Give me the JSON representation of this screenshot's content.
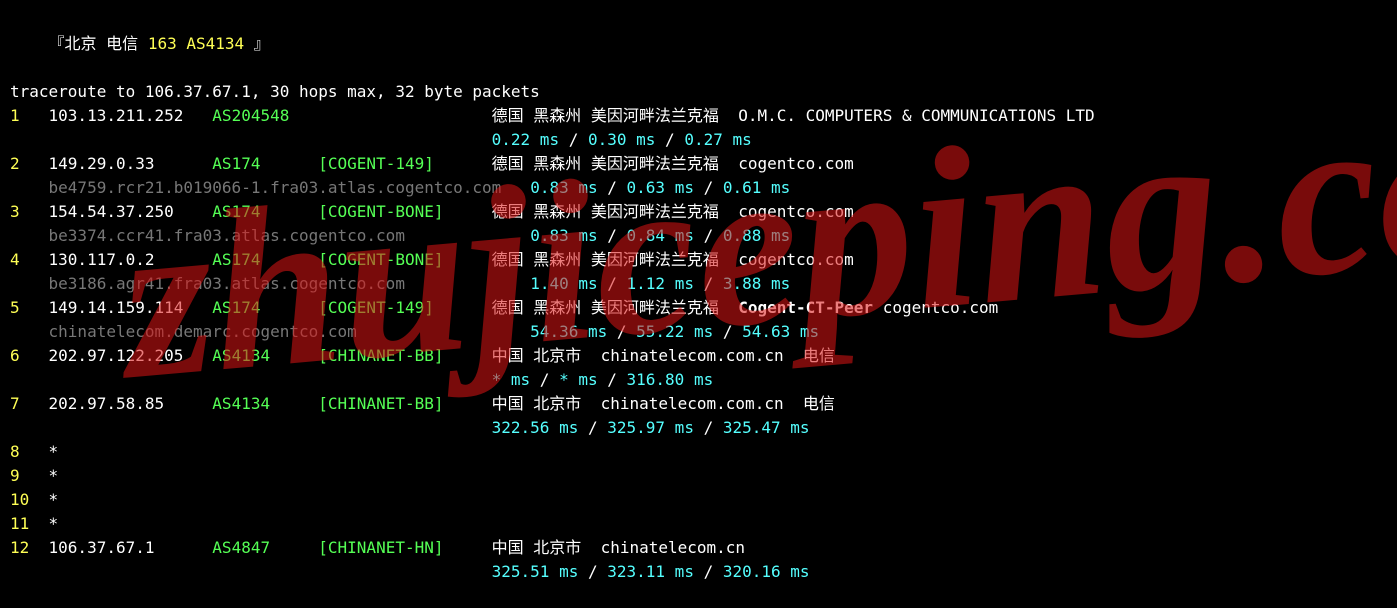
{
  "header": {
    "line1_prefix": "『北京 电信 ",
    "line1_yellow": "163 AS4134",
    "line1_suffix": " 』",
    "line2": "traceroute to 106.37.67.1, 30 hops max, 32 byte packets"
  },
  "watermark": "zhujiceping.com",
  "hops": [
    {
      "n": "1",
      "ip": "103.13.211.252",
      "asn": "AS204548",
      "tag": "",
      "loc": "德国 黑森州 美因河畔法兰克福",
      "org": "O.M.C. COMPUTERS & COMMUNICATIONS LTD",
      "rdns": "",
      "rtt": [
        "0.22 ms",
        "0.30 ms",
        "0.27 ms"
      ]
    },
    {
      "n": "2",
      "ip": "149.29.0.33",
      "asn": "AS174",
      "tag": "[COGENT-149]",
      "loc": "德国 黑森州 美因河畔法兰克福",
      "org": "cogentco.com",
      "rdns": "be4759.rcr21.b019066-1.fra03.atlas.cogentco.com",
      "rtt": [
        "0.83 ms",
        "0.63 ms",
        "0.61 ms"
      ]
    },
    {
      "n": "3",
      "ip": "154.54.37.250",
      "asn": "AS174",
      "tag": "[COGENT-BONE]",
      "loc": "德国 黑森州 美因河畔法兰克福",
      "org": "cogentco.com",
      "rdns": "be3374.ccr41.fra03.atlas.cogentco.com",
      "rtt": [
        "0.83 ms",
        "0.84 ms",
        "0.88 ms"
      ]
    },
    {
      "n": "4",
      "ip": "130.117.0.2",
      "asn": "AS174",
      "tag": "[COGENT-BONE]",
      "loc": "德国 黑森州 美因河畔法兰克福",
      "org": "cogentco.com",
      "rdns": "be3186.agr41.fra03.atlas.cogentco.com",
      "rtt": [
        "1.40 ms",
        "1.12 ms",
        "3.88 ms"
      ]
    },
    {
      "n": "5",
      "ip": "149.14.159.114",
      "asn": "AS174",
      "tag": "[COGENT-149]",
      "loc": "德国 黑森州 美因河畔法兰克福",
      "org_bold": "Cogent-CT-Peer",
      "org": "cogentco.com",
      "rdns": "chinatelecom.demarc.cogentco.com",
      "rtt": [
        "54.36 ms",
        "55.22 ms",
        "54.63 ms"
      ]
    },
    {
      "n": "6",
      "ip": "202.97.122.205",
      "asn": "AS4134",
      "tag": "[CHINANET-BB]",
      "loc": "中国 北京市",
      "org": "chinatelecom.com.cn  电信",
      "rdns": "",
      "rtt": [
        "* ms",
        "* ms",
        "316.80 ms"
      ]
    },
    {
      "n": "7",
      "ip": "202.97.58.85",
      "asn": "AS4134",
      "tag": "[CHINANET-BB]",
      "loc": "中国 北京市",
      "org": "chinatelecom.com.cn  电信",
      "rdns": "",
      "rtt": [
        "322.56 ms",
        "325.97 ms",
        "325.47 ms"
      ]
    },
    {
      "n": "8",
      "ip": "*",
      "asn": "",
      "tag": "",
      "loc": "",
      "org": "",
      "rdns": "",
      "rtt": []
    },
    {
      "n": "9",
      "ip": "*",
      "asn": "",
      "tag": "",
      "loc": "",
      "org": "",
      "rdns": "",
      "rtt": []
    },
    {
      "n": "10",
      "ip": "*",
      "asn": "",
      "tag": "",
      "loc": "",
      "org": "",
      "rdns": "",
      "rtt": []
    },
    {
      "n": "11",
      "ip": "*",
      "asn": "",
      "tag": "",
      "loc": "",
      "org": "",
      "rdns": "",
      "rtt": []
    },
    {
      "n": "12",
      "ip": "106.37.67.1",
      "asn": "AS4847",
      "tag": "[CHINANET-HN]",
      "loc": "中国 北京市",
      "org": "chinatelecom.cn",
      "rdns": "",
      "rtt": [
        "325.51 ms",
        "323.11 ms",
        "320.16 ms"
      ]
    }
  ]
}
